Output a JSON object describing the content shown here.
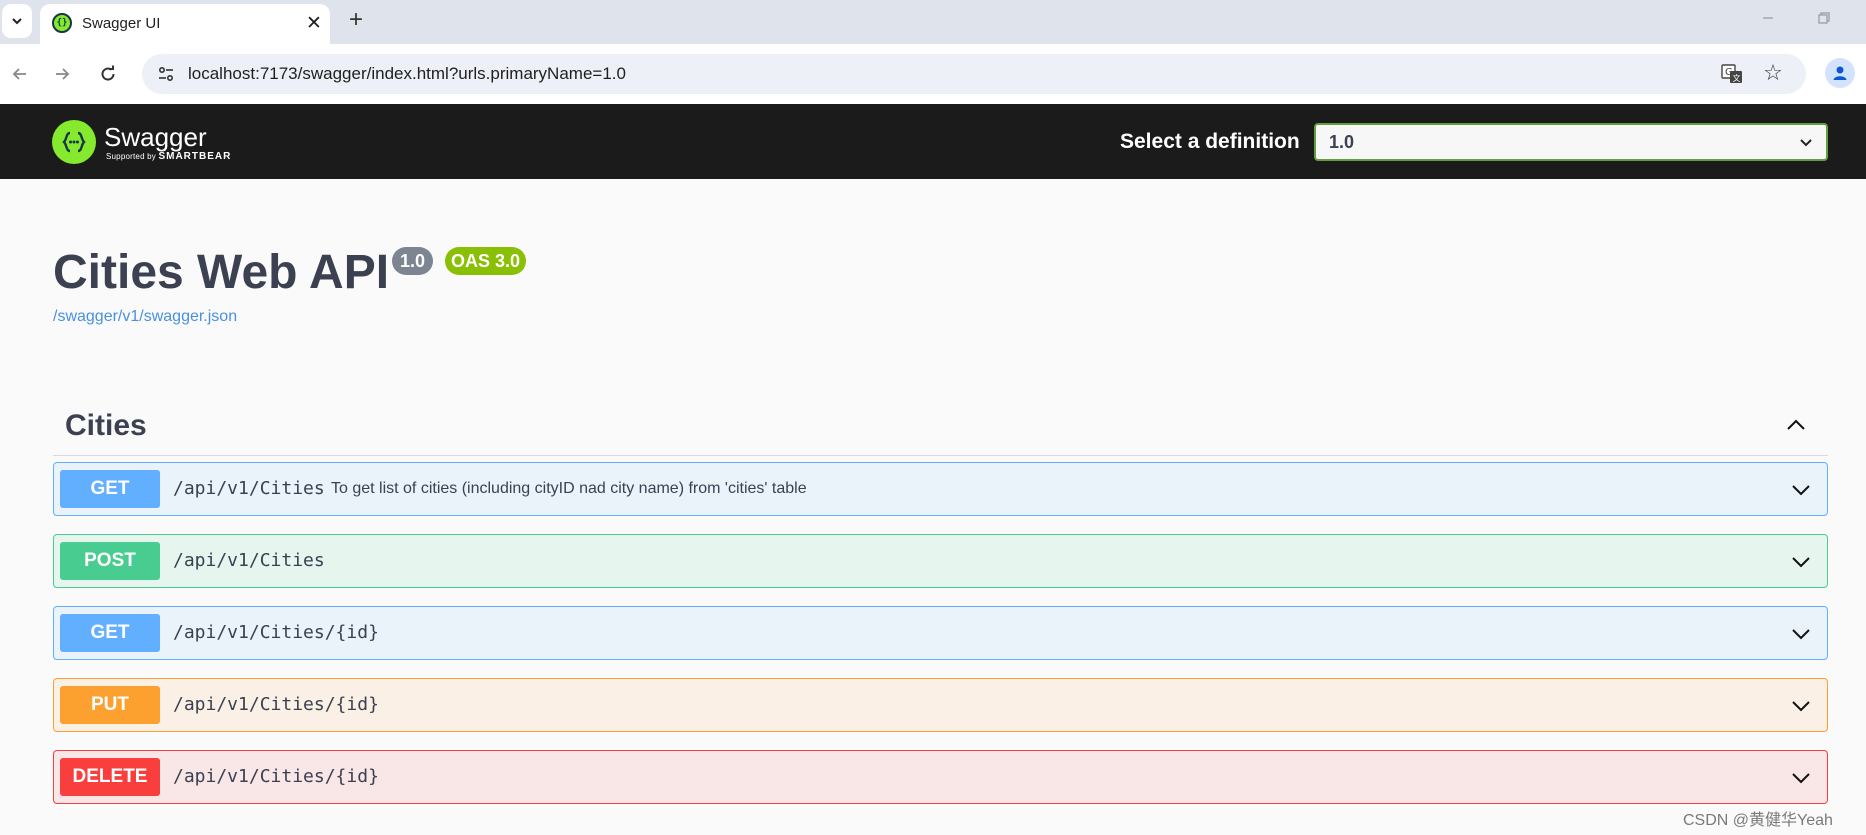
{
  "browser": {
    "tab_title": "Swagger UI",
    "tab_close": "✕",
    "new_tab": "+",
    "url": "localhost:7173/swagger/index.html?urls.primaryName=1.0"
  },
  "topbar": {
    "logo_name": "Swagger",
    "logo_sub_prefix": "Supported by",
    "logo_sub_brand": "SMARTBEAR",
    "definition_label": "Select a definition",
    "definition_value": "1.0"
  },
  "info": {
    "title": "Cities Web API",
    "version_badge": "1.0",
    "oas_badge": "OAS 3.0",
    "spec_link": "/swagger/v1/swagger.json"
  },
  "tag": {
    "name": "Cities",
    "operations": [
      {
        "method": "GET",
        "path": "/api/v1/Cities",
        "summary": "To get list of cities (including cityID nad city name) from 'cities' table"
      },
      {
        "method": "POST",
        "path": "/api/v1/Cities",
        "summary": ""
      },
      {
        "method": "GET",
        "path": "/api/v1/Cities/{id}",
        "summary": ""
      },
      {
        "method": "PUT",
        "path": "/api/v1/Cities/{id}",
        "summary": ""
      },
      {
        "method": "DELETE",
        "path": "/api/v1/Cities/{id}",
        "summary": ""
      }
    ]
  },
  "watermark": "CSDN @黄健华Yeah",
  "colors": {
    "get": "#61affe",
    "post": "#49cc90",
    "put": "#fca130",
    "delete": "#f93e3e",
    "topbar": "#1b1b1b",
    "swagger_green": "#85ea2d",
    "oas_badge": "#89bf04",
    "version_badge": "#7d8492"
  }
}
